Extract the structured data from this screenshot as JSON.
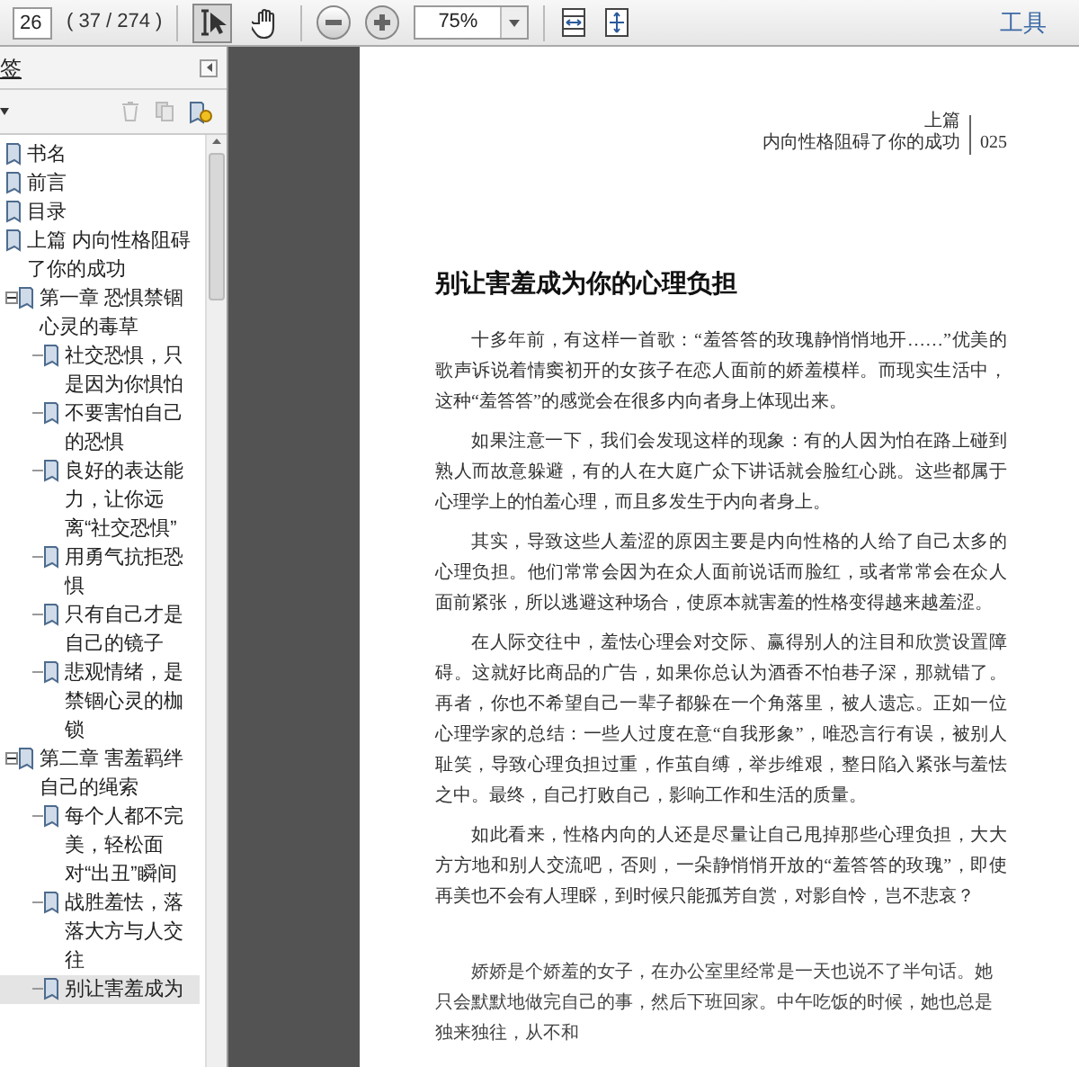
{
  "toolbar": {
    "page_number": "26",
    "page_count": "( 37 / 274 )",
    "tools": [
      {
        "kind": "select",
        "selected": true
      },
      {
        "kind": "hand",
        "selected": false
      }
    ],
    "zoom": "75%",
    "tools_label": "工具"
  },
  "sidebar": {
    "title": "签",
    "bookmarks": [
      {
        "label": "书名",
        "selected": false
      },
      {
        "label": "前言",
        "selected": false
      },
      {
        "label": "目录",
        "selected": false
      },
      {
        "label": "上篇 内向性格阻碍了你的成功",
        "selected": false,
        "children": [
          {
            "label": "第一章 恐惧禁锢心灵的毒草",
            "selected": false,
            "expanded": true,
            "children": [
              {
                "label": "社交恐惧，只是因为你惧怕",
                "selected": false
              },
              {
                "label": "不要害怕自己的恐惧",
                "selected": false
              },
              {
                "label": "良好的表达能力，让你远离“社交恐惧”",
                "selected": false
              },
              {
                "label": "用勇气抗拒恐惧",
                "selected": false
              },
              {
                "label": "只有自己才是自己的镜子",
                "selected": false
              },
              {
                "label": "悲观情绪，是禁锢心灵的枷锁",
                "selected": false
              }
            ]
          },
          {
            "label": "第二章 害羞羁绊自己的绳索",
            "selected": false,
            "expanded": true,
            "children": [
              {
                "label": "每个人都不完美，轻松面对“出丑”瞬间",
                "selected": false
              },
              {
                "label": "战胜羞怯，落落大方与人交往",
                "selected": false
              },
              {
                "label": "别让害羞成为",
                "selected": true
              }
            ]
          }
        ]
      }
    ]
  },
  "page": {
    "header_part": "上篇",
    "header_title": "内向性格阻碍了你的成功",
    "page_number": "025",
    "title": "别让害羞成为你的心理负担",
    "paragraphs": [
      {
        "kind": "body",
        "text": "十多年前，有这样一首歌：“羞答答的玫瑰静悄悄地开……”优美的歌声诉说着情窦初开的女孩子在恋人面前的娇羞模样。而现实生活中，这种“羞答答”的感觉会在很多内向者身上体现出来。"
      },
      {
        "kind": "body",
        "text": "如果注意一下，我们会发现这样的现象：有的人因为怕在路上碰到熟人而故意躲避，有的人在大庭广众下讲话就会脸红心跳。这些都属于心理学上的怕羞心理，而且多发生于内向者身上。"
      },
      {
        "kind": "body",
        "text": "其实，导致这些人羞涩的原因主要是内向性格的人给了自己太多的心理负担。他们常常会因为在众人面前说话而脸红，或者常常会在众人面前紧张，所以逃避这种场合，使原本就害羞的性格变得越来越羞涩。"
      },
      {
        "kind": "body",
        "text": "在人际交往中，羞怯心理会对交际、赢得别人的注目和欣赏设置障碍。这就好比商品的广告，如果你总认为酒香不怕巷子深，那就错了。再者，你也不希望自己一辈子都躲在一个角落里，被人遗忘。正如一位心理学家的总结：一些人过度在意“自我形象”，唯恐言行有误，被别人耻笑，导致心理负担过重，作茧自缚，举步维艰，整日陷入紧张与羞怯之中。最终，自己打败自己，影响工作和生活的质量。"
      },
      {
        "kind": "body",
        "text": "如此看来，性格内向的人还是尽量让自己甩掉那些心理负担，大大方方地和别人交流吧，否则，一朵静悄悄开放的“羞答答的玫瑰”，即使再美也不会有人理睬，到时候只能孤芳自赏，对影自怜，岂不悲哀？"
      },
      {
        "kind": "case",
        "text": "娇娇是个娇羞的女子，在办公室里经常是一天也说不了半句话。她只会默默地做完自己的事，然后下班回家。中午吃饭的时候，她也总是独来独往，从不和"
      }
    ]
  }
}
